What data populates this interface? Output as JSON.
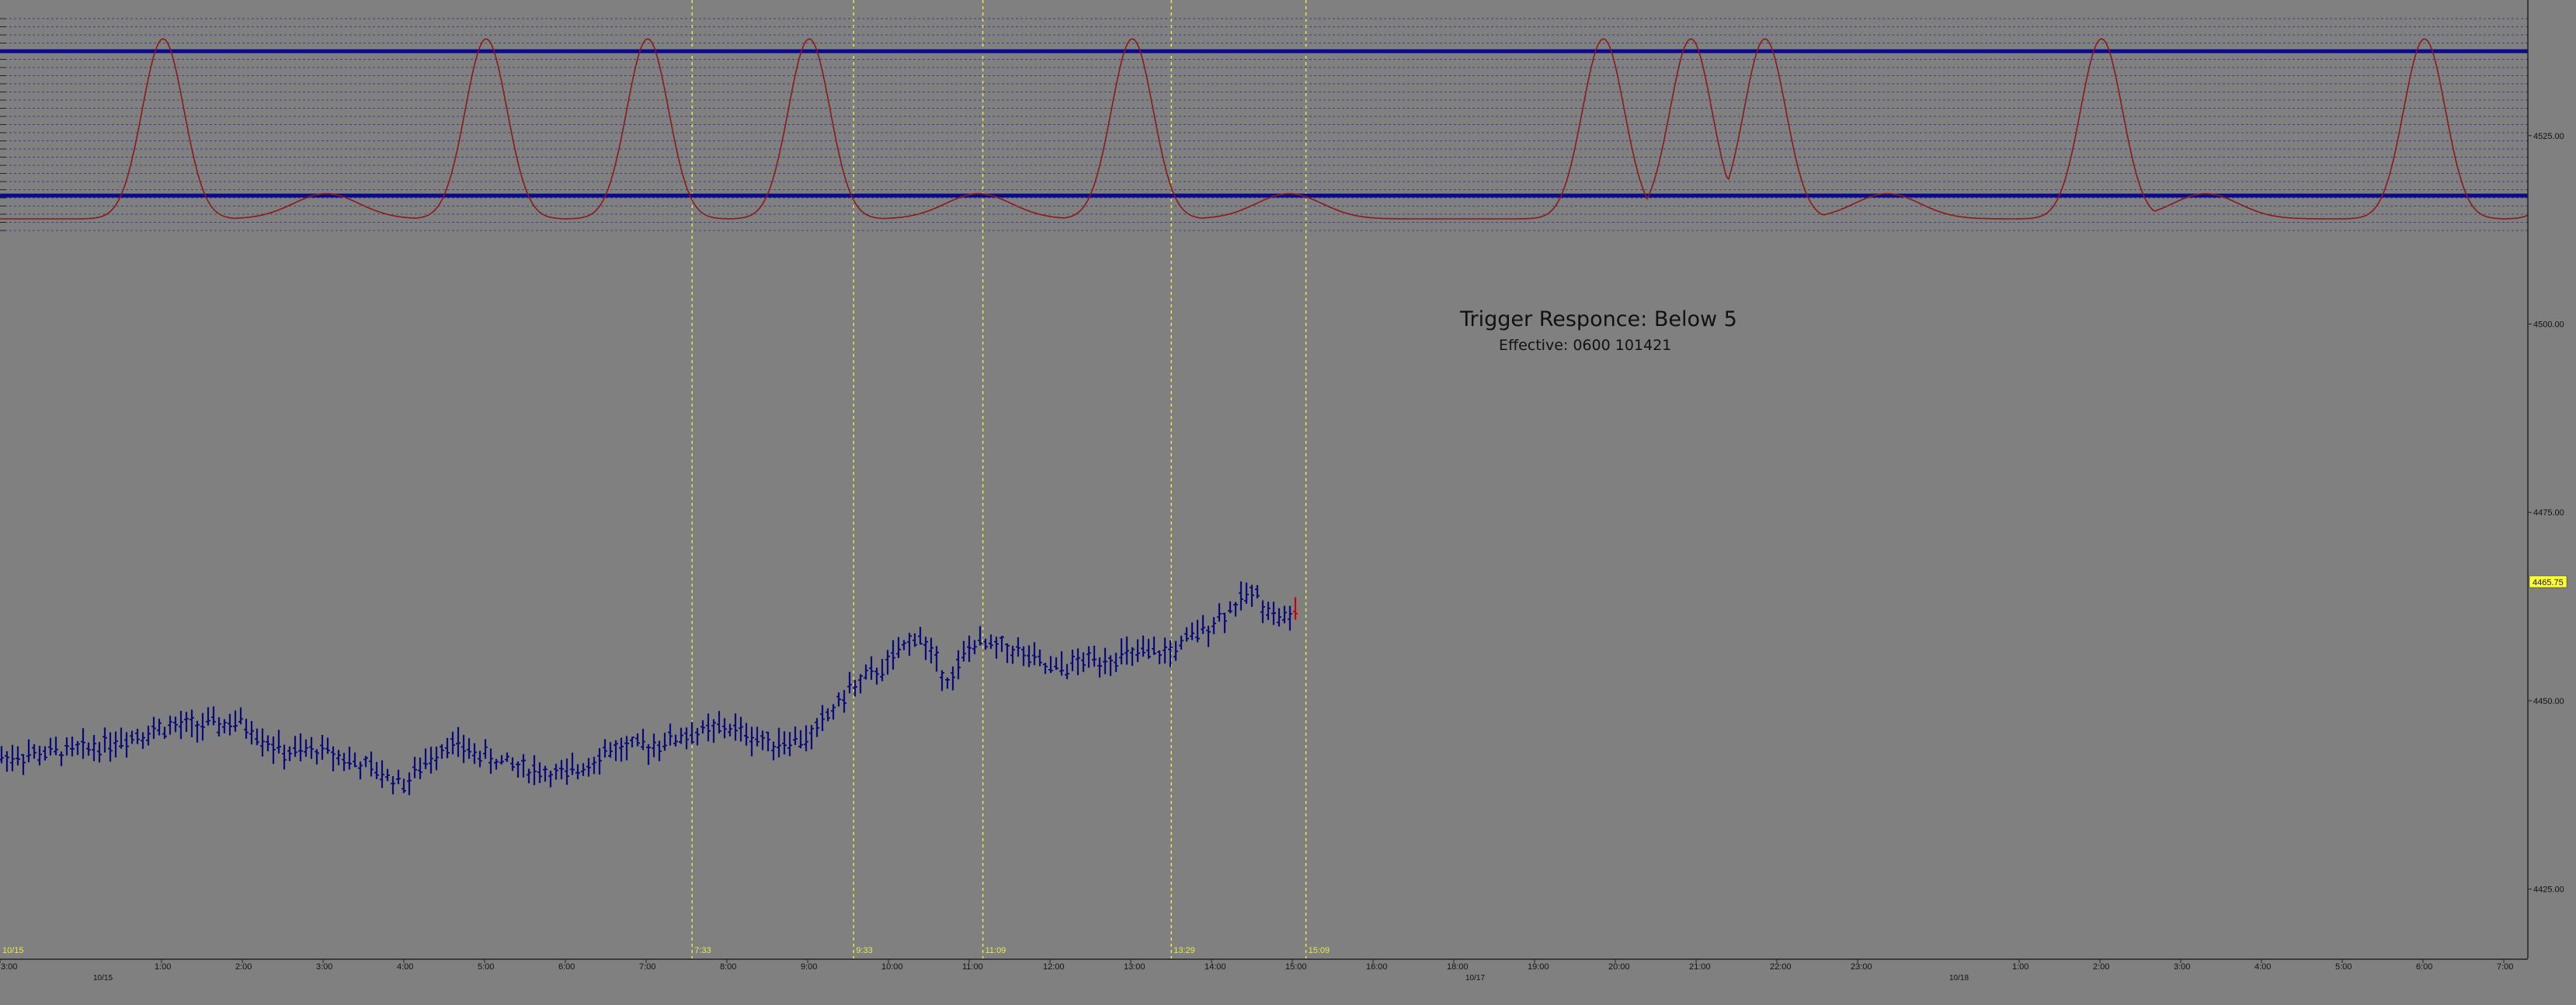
{
  "annotation": {
    "title": "Trigger Responce: Below 5",
    "subtitle": "Effective: 0600 101421"
  },
  "colors": {
    "background": "#808080",
    "price_bars": "#0a0a7a",
    "last_bar": "#cc0000",
    "oscillator": "#8b1a1a",
    "band_lines": "#0a0a8a",
    "marker_lines": "#e6e64d",
    "price_label_bg": "#ffff33"
  },
  "chart_data": [
    {
      "type": "line",
      "name": "price",
      "y_axis_ticks": [
        "4525.00",
        "4500.00",
        "4475.00",
        "4450.00",
        "4425.00"
      ],
      "ylim": [
        4415.8,
        4543.0
      ],
      "current_price_label": "4465.75",
      "x_axis": {
        "hour_labels": [
          "3:00",
          "1:00",
          "2:00",
          "3:00",
          "4:00",
          "5:00",
          "6:00",
          "7:00",
          "8:00",
          "9:00",
          "10:00",
          "11:00",
          "12:00",
          "13:00",
          "14:00",
          "15:00",
          "16:00",
          "18:00",
          "19:00",
          "20:00",
          "21:00",
          "22:00",
          "23:00",
          "1:00",
          "2:00",
          "3:00",
          "4:00",
          "5:00",
          "6:00",
          "7:00"
        ],
        "date_labels": [
          "10/15",
          "10/17",
          "10/18"
        ],
        "top_row_label": "10/15",
        "x_range": [
          "10/14 23:00",
          "10/18 7:00"
        ]
      },
      "marker_times": [
        "7:33",
        "9:33",
        "11:09",
        "13:29",
        "15:09"
      ],
      "close_series": [
        {
          "t": "10/14 23:00",
          "v": 4442.5
        },
        {
          "t": "10/15 0:00",
          "v": 4443.5
        },
        {
          "t": "10/15 1:00",
          "v": 4446.5
        },
        {
          "t": "10/15 2:00",
          "v": 4447.0
        },
        {
          "t": "10/15 2:30",
          "v": 4443.0
        },
        {
          "t": "10/15 3:00",
          "v": 4443.5
        },
        {
          "t": "10/15 4:00",
          "v": 4439.0
        },
        {
          "t": "10/15 4:30",
          "v": 4444.5
        },
        {
          "t": "10/15 5:00",
          "v": 4442.5
        },
        {
          "t": "10/15 5:30",
          "v": 4441.0
        },
        {
          "t": "10/15 6:00",
          "v": 4440.0
        },
        {
          "t": "10/15 6:30",
          "v": 4443.5
        },
        {
          "t": "10/15 7:00",
          "v": 4444.0
        },
        {
          "t": "10/15 7:30",
          "v": 4445.5
        },
        {
          "t": "10/15 8:00",
          "v": 4446.5
        },
        {
          "t": "10/15 8:30",
          "v": 4444.5
        },
        {
          "t": "10/15 9:00",
          "v": 4445.0
        },
        {
          "t": "10/15 9:30",
          "v": 4451.5
        },
        {
          "t": "10/15 10:00",
          "v": 4455.0
        },
        {
          "t": "10/15 10:20",
          "v": 4459.0
        },
        {
          "t": "10/15 10:45",
          "v": 4452.5
        },
        {
          "t": "10/15 11:00",
          "v": 4457.5
        },
        {
          "t": "10/15 11:30",
          "v": 4457.0
        },
        {
          "t": "10/15 12:00",
          "v": 4454.0
        },
        {
          "t": "10/15 12:30",
          "v": 4455.5
        },
        {
          "t": "10/15 13:00",
          "v": 4456.0
        },
        {
          "t": "10/15 13:30",
          "v": 4456.5
        },
        {
          "t": "10/15 14:00",
          "v": 4460.5
        },
        {
          "t": "10/15 14:30",
          "v": 4464.5
        },
        {
          "t": "10/15 14:45",
          "v": 4461.5
        },
        {
          "t": "10/15 15:00",
          "v": 4460.5
        },
        {
          "t": "10/15 15:03",
          "v": 4465.0
        }
      ]
    },
    {
      "type": "line",
      "name": "oscillator",
      "band_levels": [
        "upper",
        "lower"
      ],
      "peaks": [
        "10/15 1:00",
        "10/15 5:00",
        "10/15 7:00",
        "10/15 9:00",
        "10/15 13:00",
        "10/15 18:50",
        "10/15 19:55",
        "10/15 20:50",
        "10/16 1:00",
        "10/16 5:00",
        "10/16 7:00"
      ]
    }
  ]
}
